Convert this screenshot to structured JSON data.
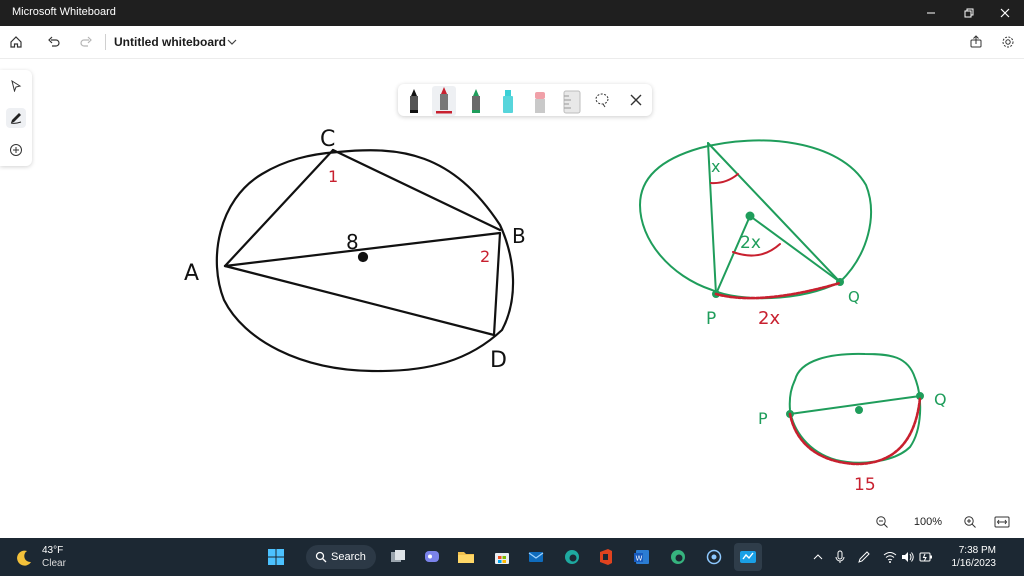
{
  "window": {
    "title": "Microsoft Whiteboard"
  },
  "appbar": {
    "board_title": "Untitled whiteboard"
  },
  "canvas": {
    "left_circle_labels": {
      "c": "C",
      "b": "B",
      "a": "A",
      "d": "D",
      "center": "8",
      "angle1": "1",
      "angle2": "2"
    },
    "right_top_labels": {
      "x": "x",
      "two_x": "2x",
      "p": "P",
      "q": "Q",
      "arc": "2x"
    },
    "right_bottom_labels": {
      "p": "P",
      "q": "Q",
      "arc": "15"
    },
    "colors": {
      "ink": "#111111",
      "green": "#1f9d5b",
      "red": "#c8202f"
    }
  },
  "zoom": {
    "level": "100%"
  },
  "taskbar": {
    "weather_temp": "43°F",
    "weather_condition": "Clear",
    "search_label": "Search",
    "time": "7:38 PM",
    "date": "1/16/2023"
  }
}
